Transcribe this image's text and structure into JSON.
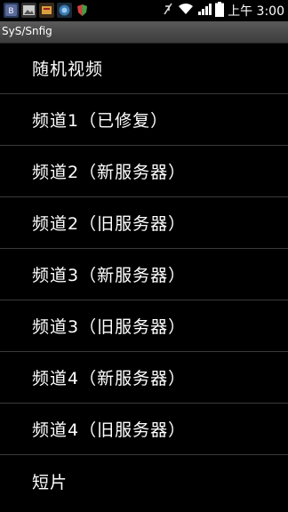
{
  "status_bar": {
    "time": "上午 3:00",
    "icons_left": [
      "app-icon-1",
      "image-icon",
      "app-icon-3",
      "app-icon-4",
      "shield-icon"
    ],
    "icons_right": [
      "mute-icon",
      "wifi-icon",
      "signal-icon",
      "battery-icon"
    ]
  },
  "title_bar": {
    "title": "SyS/Snfig"
  },
  "menu": {
    "items": [
      {
        "label": "随机视频"
      },
      {
        "label": "频道1（已修复）"
      },
      {
        "label": "频道2（新服务器）"
      },
      {
        "label": "频道2（旧服务器）"
      },
      {
        "label": "频道3（新服务器）"
      },
      {
        "label": "频道3（旧服务器）"
      },
      {
        "label": "频道4（新服务器）"
      },
      {
        "label": "频道4（旧服务器）"
      },
      {
        "label": "短片"
      }
    ]
  },
  "colors": {
    "background": "#000000",
    "text": "#ffffff",
    "divider": "#3a3a3a",
    "title_bar": "#4a4a4a"
  }
}
